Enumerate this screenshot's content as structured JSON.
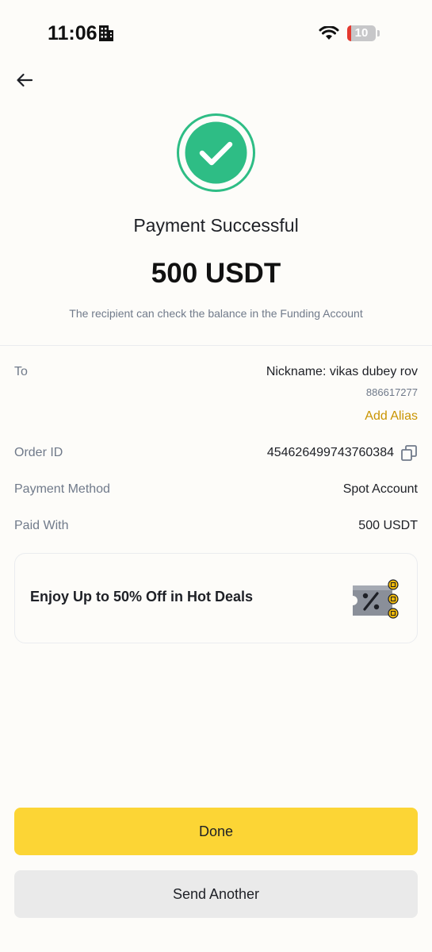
{
  "status_bar": {
    "time": "11:06",
    "battery_level": "10"
  },
  "header": {
    "back_icon": "arrow-left-icon"
  },
  "result": {
    "icon": "check-circle-icon",
    "title": "Payment Successful",
    "amount": "500 USDT",
    "note": "The recipient can check the balance in the Funding Account"
  },
  "details": {
    "to_label": "To",
    "to_value": "Nickname: vikas dubey rov",
    "to_id": "886617277",
    "add_alias": "Add Alias",
    "order_label": "Order ID",
    "order_value": "454626499743760384",
    "method_label": "Payment Method",
    "method_value": "Spot Account",
    "paid_label": "Paid With",
    "paid_value": "500 USDT"
  },
  "promo": {
    "text": "Enjoy Up to 50% Off in Hot Deals",
    "icon": "coupon-icon"
  },
  "buttons": {
    "done": "Done",
    "send_another": "Send Another"
  },
  "colors": {
    "accent": "#fcd535",
    "success": "#2ebd85",
    "link": "#c99400"
  }
}
